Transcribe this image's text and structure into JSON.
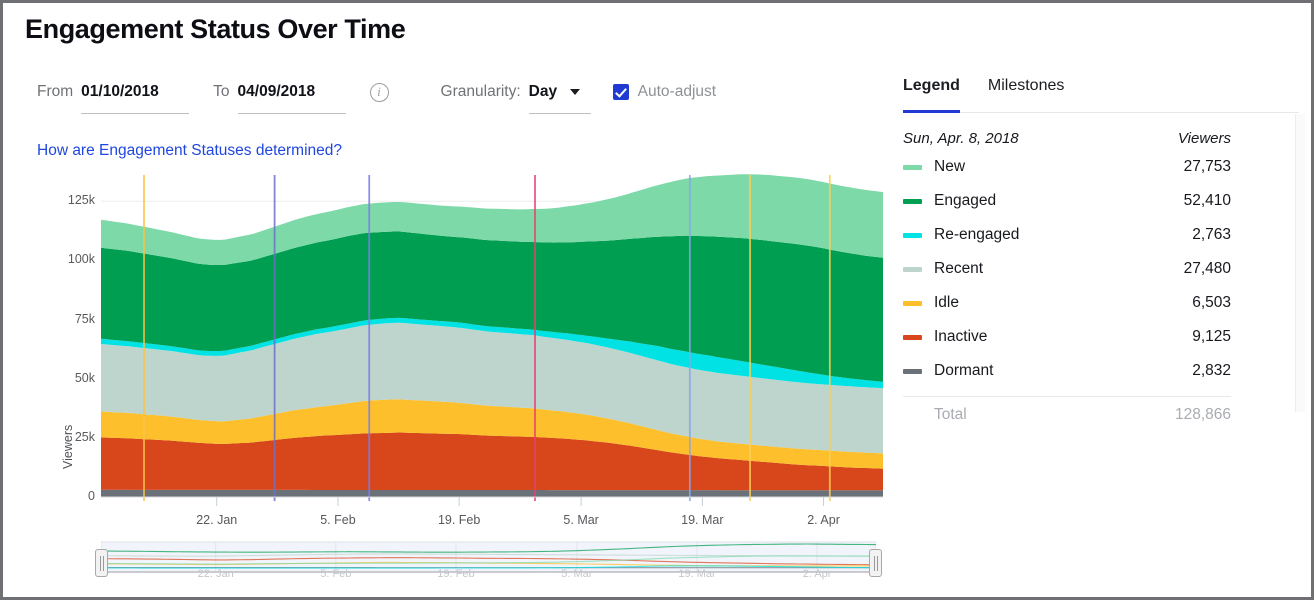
{
  "header": {
    "title": "Engagement Status Over Time"
  },
  "controls": {
    "from_label": "From",
    "from_value": "01/10/2018",
    "to_label": "To",
    "to_value": "04/09/2018",
    "info_icon": "info-icon",
    "granularity_label": "Granularity:",
    "granularity_value": "Day",
    "granularity_options": [
      "Day"
    ],
    "auto_adjust_label": "Auto-adjust",
    "auto_adjust_checked": true,
    "help_link": "How are Engagement Statuses determined?"
  },
  "right_panel": {
    "tabs": [
      {
        "label": "Legend",
        "active": true
      },
      {
        "label": "Milestones",
        "active": false
      }
    ],
    "legend": {
      "date_header": "Sun, Apr. 8, 2018",
      "value_header": "Viewers",
      "rows": [
        {
          "label": "New",
          "value": "27,753",
          "color": "#7ed9a9"
        },
        {
          "label": "Engaged",
          "value": "52,410",
          "color": "#009e51"
        },
        {
          "label": "Re-engaged",
          "value": "2,763",
          "color": "#00e2e4"
        },
        {
          "label": "Recent",
          "value": "27,480",
          "color": "#bdd5cd"
        },
        {
          "label": "Idle",
          "value": "6,503",
          "color": "#fdc02c"
        },
        {
          "label": "Inactive",
          "value": "9,125",
          "color": "#d8471c"
        },
        {
          "label": "Dormant",
          "value": "2,832",
          "color": "#6b7178"
        }
      ],
      "total_label": "Total",
      "total_value": "128,866"
    }
  },
  "chart_data": {
    "type": "area",
    "title": "Engagement Status Over Time",
    "stacked": true,
    "xlabel": "",
    "ylabel": "Viewers",
    "ylim": [
      0,
      131000
    ],
    "yticks": [
      "0",
      "25k",
      "50k",
      "75k",
      "100k",
      "125k"
    ],
    "ytick_values": [
      0,
      25000,
      50000,
      75000,
      100000,
      125000
    ],
    "xticks": [
      "22. Jan",
      "5. Feb",
      "19. Feb",
      "5. Mar",
      "19. Mar",
      "2. Apr"
    ],
    "xtick_positions": [
      0.148,
      0.303,
      0.458,
      0.614,
      0.769,
      0.924
    ],
    "x_range": [
      "01/10/2018",
      "04/09/2018"
    ],
    "grid": true,
    "legend_position": "right-panel",
    "series": [
      {
        "name": "Dormant",
        "color": "#6b7178",
        "values": [
          3050,
          3045,
          3040,
          3035,
          3030,
          3028,
          3025,
          3022,
          3020,
          3018,
          3015,
          3012,
          3010,
          3008,
          3005,
          3002,
          3000,
          2998,
          2996,
          2994,
          2992,
          2990,
          2988,
          2986,
          2984,
          2982,
          2980,
          2978,
          2976,
          2974,
          2972,
          2970,
          2968,
          2966,
          2964,
          2962,
          2960,
          2958,
          2956,
          2954,
          2952,
          2950,
          2948,
          2946,
          2944,
          2942,
          2940,
          2938,
          2936,
          2934,
          2932,
          2930,
          2928,
          2926,
          2924,
          2922,
          2920,
          2918,
          2916,
          2914,
          2912,
          2910,
          2905,
          2900,
          2895,
          2890,
          2888,
          2886,
          2884,
          2882,
          2880,
          2878,
          2876,
          2874,
          2872,
          2870,
          2866,
          2862,
          2858,
          2854,
          2850,
          2846,
          2844,
          2842,
          2840,
          2838,
          2836,
          2834,
          2832,
          2832
        ]
      },
      {
        "name": "Inactive",
        "color": "#d8471c",
        "values": [
          22100,
          22000,
          21900,
          21800,
          21600,
          21400,
          21200,
          21000,
          20800,
          20500,
          20200,
          19900,
          19700,
          19500,
          19400,
          19600,
          19800,
          20000,
          20400,
          20800,
          21200,
          21600,
          22000,
          22300,
          22600,
          22900,
          23100,
          23300,
          23500,
          23700,
          23900,
          24000,
          24100,
          24200,
          24300,
          24200,
          24100,
          24000,
          23900,
          23800,
          23700,
          23600,
          23400,
          23200,
          23000,
          22900,
          22800,
          22700,
          22600,
          22500,
          22300,
          22100,
          21900,
          21700,
          21400,
          21100,
          20700,
          20300,
          19900,
          19400,
          18900,
          18300,
          17700,
          17100,
          16500,
          15900,
          15400,
          14900,
          14400,
          14000,
          13600,
          13300,
          13000,
          12700,
          12400,
          12100,
          11800,
          11500,
          11200,
          10900,
          10700,
          10500,
          10300,
          10100,
          9900,
          9700,
          9550,
          9400,
          9250,
          9125
        ]
      },
      {
        "name": "Idle",
        "color": "#fdc02c",
        "values": [
          11000,
          10900,
          10800,
          10700,
          10600,
          10500,
          10400,
          10300,
          10150,
          10000,
          9850,
          9700,
          9600,
          9550,
          9600,
          9800,
          10000,
          10200,
          10500,
          10800,
          11100,
          11400,
          11700,
          11900,
          12100,
          12300,
          12500,
          12800,
          13100,
          13400,
          13700,
          13900,
          14000,
          14050,
          14000,
          13900,
          13800,
          13700,
          13600,
          13500,
          13400,
          13200,
          13000,
          12800,
          12600,
          12500,
          12400,
          12300,
          12200,
          12100,
          11900,
          11700,
          11500,
          11300,
          11100,
          10900,
          10700,
          10400,
          10100,
          9800,
          9500,
          9200,
          8900,
          8600,
          8300,
          8000,
          7800,
          7600,
          7400,
          7250,
          7100,
          7000,
          6950,
          6900,
          6850,
          6800,
          6780,
          6760,
          6740,
          6720,
          6700,
          6680,
          6660,
          6640,
          6620,
          6600,
          6570,
          6540,
          6520,
          6503
        ]
      },
      {
        "name": "Recent",
        "color": "#bdd5cd",
        "values": [
          28500,
          28400,
          28300,
          28200,
          28100,
          28000,
          27900,
          27800,
          27700,
          27600,
          27500,
          27400,
          27450,
          27600,
          27800,
          28100,
          28400,
          28700,
          29000,
          29300,
          29600,
          29900,
          30200,
          30500,
          30800,
          31000,
          31200,
          31400,
          31600,
          31800,
          32000,
          32100,
          32200,
          32300,
          32350,
          32300,
          32200,
          32100,
          32000,
          31900,
          31800,
          31700,
          31600,
          31500,
          31400,
          31300,
          31200,
          31100,
          31000,
          30900,
          30800,
          30700,
          30600,
          30500,
          30400,
          30300,
          30200,
          30100,
          30000,
          29900,
          29800,
          29700,
          29600,
          29500,
          29400,
          29300,
          29200,
          29150,
          29100,
          29050,
          29000,
          28900,
          28800,
          28700,
          28600,
          28500,
          28400,
          28300,
          28200,
          28100,
          28000,
          27900,
          27850,
          27800,
          27750,
          27700,
          27650,
          27600,
          27550,
          27480
        ]
      },
      {
        "name": "Re-engaged",
        "color": "#00e2e4",
        "values": [
          2200,
          2180,
          2160,
          2140,
          2120,
          2100,
          2080,
          2060,
          2050,
          2040,
          2030,
          2020,
          2010,
          2000,
          1990,
          1980,
          1970,
          1960,
          1950,
          1940,
          1930,
          1930,
          1940,
          1950,
          1960,
          1970,
          1980,
          1990,
          2000,
          2010,
          2020,
          2030,
          2040,
          2050,
          2060,
          2070,
          2080,
          2090,
          2100,
          2120,
          2140,
          2160,
          2180,
          2200,
          2220,
          2240,
          2260,
          2280,
          2300,
          2350,
          2400,
          2500,
          2600,
          2750,
          2900,
          3100,
          3300,
          3600,
          3900,
          4300,
          4700,
          5100,
          5500,
          5900,
          6200,
          6400,
          6550,
          6650,
          6700,
          6700,
          6650,
          6550,
          6400,
          6200,
          6000,
          5800,
          5600,
          5400,
          5200,
          5000,
          4700,
          4400,
          4100,
          3800,
          3600,
          3400,
          3200,
          3000,
          2880,
          2763
        ]
      },
      {
        "name": "Engaged",
        "color": "#009e51",
        "values": [
          38500,
          38400,
          38300,
          38200,
          38000,
          37800,
          37600,
          37400,
          37200,
          37000,
          36800,
          36600,
          36500,
          36400,
          36300,
          36200,
          36100,
          36000,
          36000,
          36100,
          36200,
          36300,
          36400,
          36500,
          36600,
          36700,
          36800,
          36900,
          37000,
          37000,
          36900,
          36800,
          36700,
          36600,
          36500,
          36400,
          36300,
          36200,
          36100,
          36000,
          36000,
          36100,
          36200,
          36300,
          36400,
          36500,
          36600,
          36700,
          36800,
          37000,
          37300,
          37600,
          38000,
          38500,
          39000,
          39600,
          40200,
          40900,
          41600,
          42400,
          43200,
          44100,
          45000,
          45900,
          46800,
          47700,
          48500,
          49200,
          49800,
          50300,
          50800,
          51200,
          51600,
          52000,
          52300,
          52600,
          52800,
          53000,
          53200,
          53400,
          53500,
          53600,
          53500,
          53300,
          53100,
          52900,
          52750,
          52600,
          52500,
          52410
        ]
      },
      {
        "name": "New",
        "color": "#7ed9a9",
        "values": [
          11800,
          11700,
          11600,
          11500,
          11400,
          11300,
          11200,
          11100,
          11000,
          10900,
          10800,
          10700,
          10650,
          10600,
          10650,
          10750,
          10900,
          11050,
          11200,
          11350,
          11500,
          11650,
          11800,
          11900,
          12000,
          12050,
          12100,
          12150,
          12200,
          12250,
          12300,
          12350,
          12400,
          12450,
          12500,
          12550,
          12600,
          12650,
          12700,
          12800,
          12900,
          13000,
          13100,
          13200,
          13300,
          13400,
          13500,
          13600,
          13700,
          13900,
          14100,
          14400,
          14700,
          15100,
          15500,
          16000,
          16500,
          17100,
          17700,
          18400,
          19100,
          19900,
          20700,
          21500,
          22300,
          23100,
          23800,
          24400,
          24900,
          25400,
          25800,
          26200,
          26600,
          27000,
          27300,
          27600,
          27800,
          27900,
          28000,
          28050,
          28100,
          28050,
          28000,
          27950,
          27900,
          27850,
          27820,
          27790,
          27770,
          27753
        ]
      }
    ],
    "milestones": [
      {
        "position": 0.055,
        "color": "#fbc246"
      },
      {
        "position": 0.222,
        "color": "#6f70c9"
      },
      {
        "position": 0.343,
        "color": "#7c7ce8"
      },
      {
        "position": 0.555,
        "color": "#ea3f70"
      },
      {
        "position": 0.753,
        "color": "#8aa6e8"
      },
      {
        "position": 0.83,
        "color": "#fbcf55"
      },
      {
        "position": 0.932,
        "color": "#fbcf55"
      }
    ]
  }
}
